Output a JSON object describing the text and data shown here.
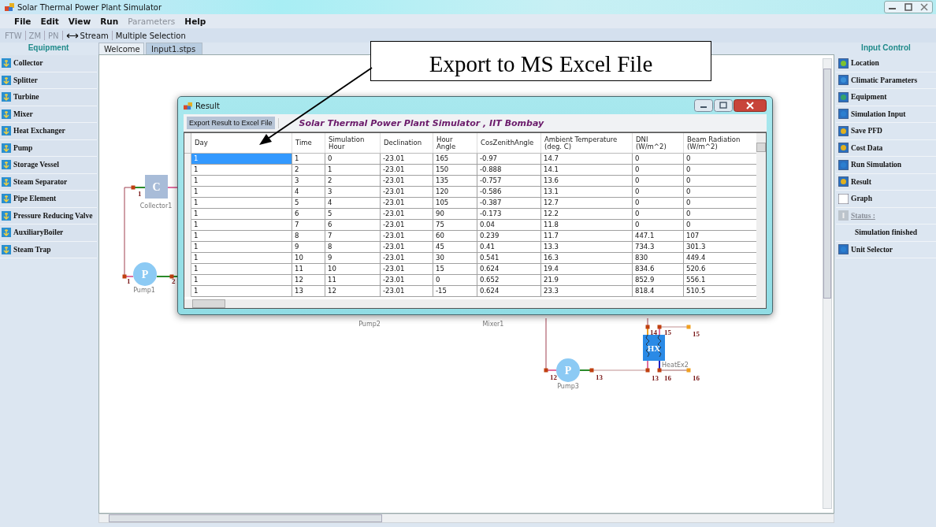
{
  "window": {
    "title": "Solar Thermal Power Plant Simulator"
  },
  "menu": [
    {
      "label": "File",
      "disabled": false
    },
    {
      "label": "Edit",
      "disabled": false
    },
    {
      "label": "View",
      "disabled": false
    },
    {
      "label": "Run",
      "disabled": false
    },
    {
      "label": "Parameters",
      "disabled": true
    },
    {
      "label": "Help",
      "disabled": false
    }
  ],
  "toolbar": [
    {
      "kind": "text",
      "label": "FTW",
      "disabled": true
    },
    {
      "kind": "text",
      "label": "ZM",
      "disabled": true
    },
    {
      "kind": "text",
      "label": "PN",
      "disabled": true
    },
    {
      "kind": "stream",
      "label": "Stream",
      "disabled": false
    },
    {
      "kind": "text",
      "label": "Multiple Selection",
      "disabled": false
    }
  ],
  "equipment": {
    "title": "Equipment",
    "items": [
      "Collector",
      "Splitter",
      "Turbine",
      "Mixer",
      "Heat Exchanger",
      "Pump",
      "Storage Vessel",
      "Steam Separator",
      "Pipe Element",
      "Pressure Reducing Valve",
      "AuxiliaryBoiler",
      "Steam Trap"
    ]
  },
  "tabs": [
    {
      "label": "Welcome",
      "selected": false
    },
    {
      "label": "Input1.stps",
      "selected": true
    }
  ],
  "diagram": {
    "nodes": [
      {
        "kind": "collector",
        "symbol": "C",
        "label": "Collector1"
      },
      {
        "kind": "pump",
        "symbol": "P",
        "label": "Pump1"
      },
      {
        "kind": "label",
        "label": "Pump2"
      },
      {
        "kind": "label",
        "label": "Mixer1"
      },
      {
        "kind": "pump",
        "symbol": "P",
        "label": "Pump3"
      },
      {
        "kind": "heat_exchanger",
        "symbol": "HX",
        "label": "HeatEx2"
      }
    ],
    "ports": [
      "1",
      "1",
      "2",
      "12",
      "13",
      "14",
      "15",
      "15",
      "13",
      "16",
      "16"
    ]
  },
  "result_window": {
    "title": "Result",
    "export_button": "Export Result to Excel File",
    "banner": "Solar Thermal Power Plant Simulator , IIT Bombay",
    "columns": [
      "Day",
      "Time",
      "Simulation\nHour",
      "Declination",
      "Hour\nAngle",
      "CosZenithAngle",
      "Ambient Temperature\n(deg. C)",
      "DNI\n(W/m^2)",
      "Beam Radiation\n(W/m^2)"
    ],
    "rows": [
      {
        "selected": true,
        "cells": [
          "1",
          "1",
          "0",
          "-23.01",
          "165",
          "-0.97",
          "14.7",
          "0",
          "0"
        ]
      },
      {
        "selected": false,
        "cells": [
          "1",
          "2",
          "1",
          "-23.01",
          "150",
          "-0.888",
          "14.1",
          "0",
          "0"
        ]
      },
      {
        "selected": false,
        "cells": [
          "1",
          "3",
          "2",
          "-23.01",
          "135",
          "-0.757",
          "13.6",
          "0",
          "0"
        ]
      },
      {
        "selected": false,
        "cells": [
          "1",
          "4",
          "3",
          "-23.01",
          "120",
          "-0.586",
          "13.1",
          "0",
          "0"
        ]
      },
      {
        "selected": false,
        "cells": [
          "1",
          "5",
          "4",
          "-23.01",
          "105",
          "-0.387",
          "12.7",
          "0",
          "0"
        ]
      },
      {
        "selected": false,
        "cells": [
          "1",
          "6",
          "5",
          "-23.01",
          "90",
          "-0.173",
          "12.2",
          "0",
          "0"
        ]
      },
      {
        "selected": false,
        "cells": [
          "1",
          "7",
          "6",
          "-23.01",
          "75",
          "0.04",
          "11.8",
          "0",
          "0"
        ]
      },
      {
        "selected": false,
        "cells": [
          "1",
          "8",
          "7",
          "-23.01",
          "60",
          "0.239",
          "11.7",
          "447.1",
          "107"
        ]
      },
      {
        "selected": false,
        "cells": [
          "1",
          "9",
          "8",
          "-23.01",
          "45",
          "0.41",
          "13.3",
          "734.3",
          "301.3"
        ]
      },
      {
        "selected": false,
        "cells": [
          "1",
          "10",
          "9",
          "-23.01",
          "30",
          "0.541",
          "16.3",
          "830",
          "449.4"
        ]
      },
      {
        "selected": false,
        "cells": [
          "1",
          "11",
          "10",
          "-23.01",
          "15",
          "0.624",
          "19.4",
          "834.6",
          "520.6"
        ]
      },
      {
        "selected": false,
        "cells": [
          "1",
          "12",
          "11",
          "-23.01",
          "0",
          "0.652",
          "21.9",
          "852.9",
          "556.1"
        ]
      },
      {
        "selected": false,
        "cells": [
          "1",
          "13",
          "12",
          "-23.01",
          "-15",
          "0.624",
          "23.3",
          "818.4",
          "510.5"
        ]
      }
    ]
  },
  "input_control": {
    "title": "Input Control",
    "items": [
      {
        "kind": "button",
        "label": "Location"
      },
      {
        "kind": "button",
        "label": "Climatic  Parameters"
      },
      {
        "kind": "button",
        "label": "Equipment"
      },
      {
        "kind": "button",
        "label": "Simulation Input"
      },
      {
        "kind": "button",
        "label": "Save PFD"
      },
      {
        "kind": "button",
        "label": "Cost Data"
      },
      {
        "kind": "button",
        "label": "Run Simulation"
      },
      {
        "kind": "button",
        "label": "Result"
      },
      {
        "kind": "button",
        "label": "Graph"
      },
      {
        "kind": "status",
        "label": "Status :"
      },
      {
        "kind": "message",
        "label": "Simulation finished"
      },
      {
        "kind": "button",
        "label": "Unit Selector"
      }
    ]
  },
  "callout": {
    "text": "Export to MS Excel File"
  }
}
